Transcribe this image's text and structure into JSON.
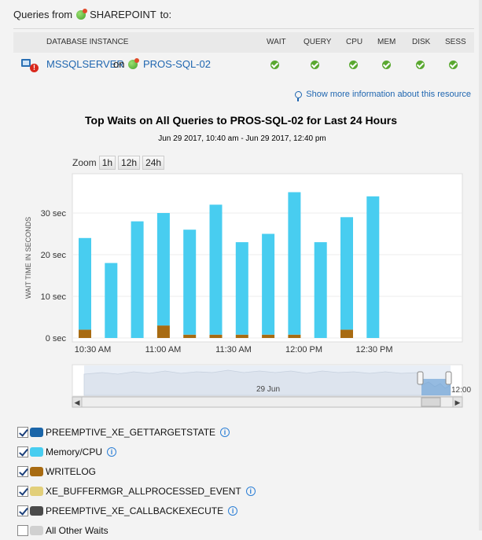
{
  "header": {
    "prefix": "Queries from",
    "source": "SHAREPOINT",
    "suffix": "to:"
  },
  "table": {
    "columns": [
      "DATABASE INSTANCE",
      "WAIT",
      "QUERY",
      "CPU",
      "MEM",
      "DISK",
      "SESS"
    ],
    "row": {
      "instance": "MSSQLSERVER",
      "on": "on",
      "server": "PROS-SQL-02",
      "statuses": [
        "ok",
        "ok",
        "ok",
        "ok",
        "ok",
        "ok"
      ]
    }
  },
  "more_info_link": "Show more information about this resource",
  "zoom": {
    "label": "Zoom",
    "buttons": [
      "1h",
      "12h",
      "24h"
    ]
  },
  "navigator": {
    "date_label": "29 Jun",
    "time_label": "12:00"
  },
  "chart_data": {
    "type": "bar",
    "title": "Top Waits on All Queries to PROS-SQL-02 for Last 24 Hours",
    "subtitle": "Jun 29 2017, 10:40 am - Jun 29 2017, 12:40 pm",
    "ylabel": "WAIT TIME IN SECONDS",
    "ylim": [
      0,
      40
    ],
    "y_ticks": [
      0,
      10,
      20,
      30
    ],
    "y_tick_labels": [
      "0 sec",
      "10 sec",
      "20 sec",
      "30 sec"
    ],
    "x_tick_labels": [
      "10:30 AM",
      "11:00 AM",
      "11:30 AM",
      "12:00 PM",
      "12:30 PM"
    ],
    "stacked": true,
    "categories": [
      "1",
      "2",
      "3",
      "4",
      "5",
      "6",
      "7",
      "8",
      "9",
      "10",
      "11",
      "12"
    ],
    "series": [
      {
        "name": "WRITELOG",
        "color": "#a86b12",
        "values": [
          2,
          0,
          0,
          0,
          0.8,
          0.8,
          0.8,
          0.8,
          0.8,
          0,
          2,
          0
        ]
      },
      {
        "name": "Memory/CPU",
        "color": "#48cdf0",
        "values": [
          22,
          18,
          28,
          27,
          25.2,
          31.2,
          22.2,
          24.2,
          34.2,
          23,
          27,
          34
        ]
      }
    ],
    "writelog_tall_index": 3,
    "writelog_tall_value": 3
  },
  "legend": [
    {
      "label": "PREEMPTIVE_XE_GETTARGETSTATE",
      "color": "#1a65a8",
      "checked": true,
      "info": true
    },
    {
      "label": "Memory/CPU",
      "color": "#48cdf0",
      "checked": true,
      "info": true
    },
    {
      "label": "WRITELOG",
      "color": "#a86b12",
      "checked": true,
      "info": false
    },
    {
      "label": "XE_BUFFERMGR_ALLPROCESSED_EVENT",
      "color": "#e2cf7a",
      "checked": true,
      "info": true
    },
    {
      "label": "PREEMPTIVE_XE_CALLBACKEXECUTE",
      "color": "#4a4a4a",
      "checked": true,
      "info": true
    },
    {
      "label": "All Other Waits",
      "color": "#d0d0d0",
      "checked": false,
      "info": false
    }
  ]
}
